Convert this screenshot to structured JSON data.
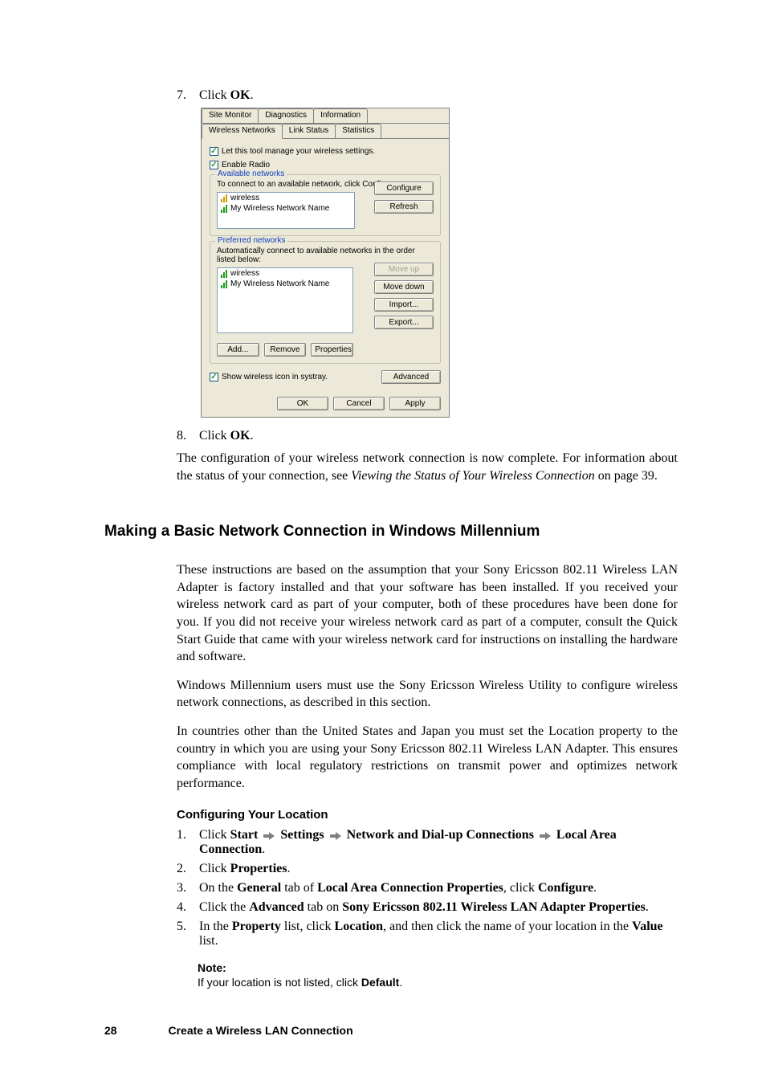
{
  "step7": {
    "num": "7.",
    "pre": "Click ",
    "bold": "OK",
    "post": "."
  },
  "dialog": {
    "tabs_top": {
      "site": "Site Monitor",
      "diag": "Diagnostics",
      "info": "Information"
    },
    "tabs_sub": {
      "wnet": "Wireless Networks",
      "link": "Link Status",
      "stats": "Statistics"
    },
    "chk_tool": "Let this tool manage your wireless settings.",
    "chk_radio": "Enable Radio",
    "available": {
      "title": "Available networks",
      "desc": "To connect to an available network, click Configure.",
      "item1": "wireless",
      "item2": "My Wireless Network Name",
      "btn_configure": "Configure",
      "btn_refresh": "Refresh"
    },
    "preferred": {
      "title": "Preferred networks",
      "desc": "Automatically connect to available networks in the order listed below:",
      "item1": "wireless",
      "item2": "My Wireless Network Name",
      "btn_up": "Move up",
      "btn_down": "Move down",
      "btn_import": "Import...",
      "btn_export": "Export...",
      "btn_add": "Add...",
      "btn_remove": "Remove",
      "btn_props": "Properties"
    },
    "chk_tray": "Show wireless icon in systray.",
    "btn_advanced": "Advanced",
    "btn_ok": "OK",
    "btn_cancel": "Cancel",
    "btn_apply": "Apply"
  },
  "step8": {
    "num": "8.",
    "pre": "Click ",
    "bold": "OK",
    "post": "."
  },
  "post_para": {
    "a": "The configuration of your wireless network connection is now complete. For information about the status of your connection, see ",
    "b": "Viewing the Status of Your Wireless Connection",
    "c": " on page 39."
  },
  "h2": "Making a Basic Network Connection in Windows Millennium",
  "p1": "These instructions are based on the assumption that your Sony Ericsson 802.11 Wireless LAN Adapter is factory installed and that your software has been installed. If you received your wireless network card as part of your computer, both of these procedures have been done for you. If you did not receive your wireless network card as part of a computer, consult the Quick Start Guide that came with your wireless network card for instructions on installing the hardware and software.",
  "p2": "Windows Millennium users must use the Sony Ericsson Wireless Utility to configure wireless network connections, as described in this section.",
  "p3": "In countries other than the United States and Japan you must set the Location property to the country in which you are using your Sony Ericsson 802.11 Wireless LAN Adapter. This ensures compliance with local regulatory restrictions on transmit power and optimizes network performance.",
  "sub1": "Configuring Your Location",
  "s1": {
    "num": "1.",
    "pre": "Click ",
    "w1": "Start",
    "w2": "Settings",
    "w3": "Network and Dial-up Connections",
    "w4": "Local Area Connection",
    "post": "."
  },
  "s2": {
    "num": "2.",
    "pre": "Click ",
    "w1": "Properties",
    "post": "."
  },
  "s3": {
    "num": "3.",
    "a": "On the ",
    "b": "General",
    "c": " tab of ",
    "d": "Local Area Connection Properties",
    "e": ", click ",
    "f": "Configure",
    "g": "."
  },
  "s4": {
    "num": "4.",
    "a": "Click the ",
    "b": "Advanced",
    "c": " tab on ",
    "d": "Sony Ericsson 802.11 Wireless LAN Adapter Properties",
    "e": "."
  },
  "s5": {
    "num": "5.",
    "a": "In the ",
    "b": "Property",
    "c": " list, click ",
    "d": "Location",
    "e": ", and then click the name of your location in the ",
    "f": "Value",
    "g": " list."
  },
  "note": {
    "title": "Note:",
    "a": "If your location is not listed, click ",
    "b": "Default",
    "c": "."
  },
  "footer": {
    "page": "28",
    "chapter": "Create a Wireless LAN Connection"
  }
}
